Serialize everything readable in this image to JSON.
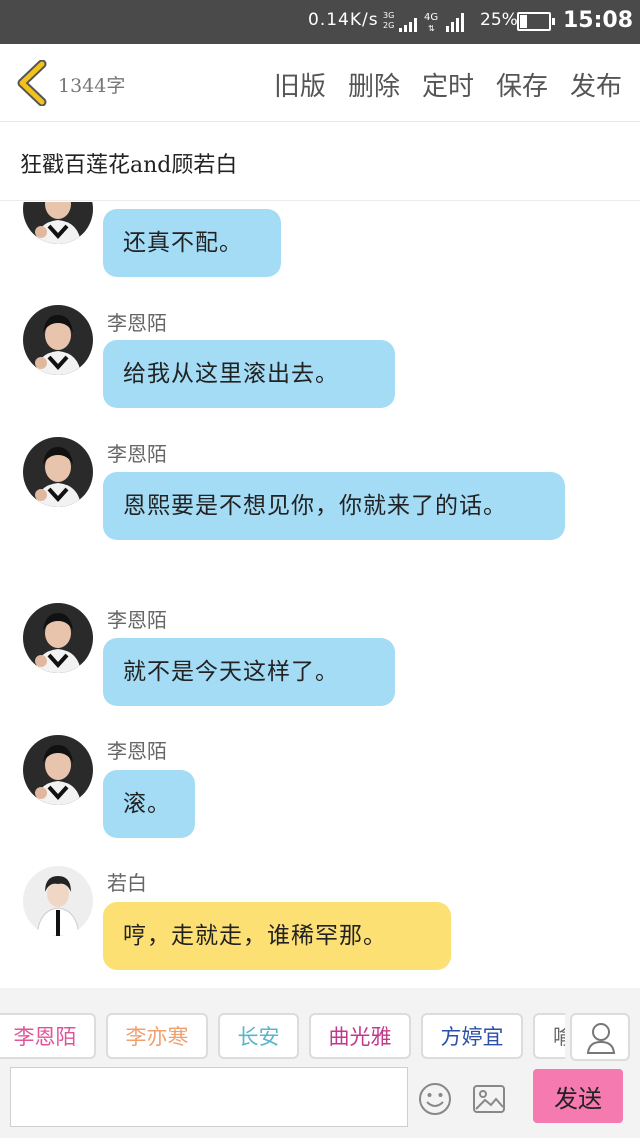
{
  "status_bar": {
    "net_speed": "0.14K/s",
    "sim1_label_top": "3G",
    "sim1_label_bottom": "2G",
    "sim2_label": "4G",
    "battery_percent": "25%",
    "battery_level": 0.25,
    "time": "15:08"
  },
  "header": {
    "word_count": "1344字",
    "actions": [
      "旧版",
      "删除",
      "定时",
      "保存",
      "发布"
    ]
  },
  "story_title": "狂戳百莲花and顾若白",
  "messages": [
    {
      "sender": "",
      "text": "还真不配。",
      "avatar": "female-avatar",
      "color": "blue"
    },
    {
      "sender": "李恩陌",
      "text": "给我从这里滚出去。",
      "avatar": "female-avatar",
      "color": "blue"
    },
    {
      "sender": "李恩陌",
      "text": "恩熙要是不想见你，你就来了的话。",
      "avatar": "female-avatar",
      "color": "blue"
    },
    {
      "sender": "李恩陌",
      "text": "就不是今天这样了。",
      "avatar": "female-avatar",
      "color": "blue"
    },
    {
      "sender": "李恩陌",
      "text": "滚。",
      "avatar": "female-avatar",
      "color": "blue"
    },
    {
      "sender": "若白",
      "text": "哼，走就走，谁稀罕那。",
      "avatar": "male-avatar",
      "color": "yellow"
    }
  ],
  "characters": [
    {
      "name": "李恩陌",
      "color": "#e0559a"
    },
    {
      "name": "李亦寒",
      "color": "#f0a070"
    },
    {
      "name": "长安",
      "color": "#5bb5c8"
    },
    {
      "name": "曲光雅",
      "color": "#c0398a"
    },
    {
      "name": "方婷宜",
      "color": "#2b4fa8"
    },
    {
      "name": "喻",
      "color": "#666666"
    }
  ],
  "input": {
    "placeholder": ""
  },
  "send_label": "发送",
  "colors": {
    "status_bar": "#4a4a4a",
    "blue_bubble": "#a4dcf6",
    "yellow_bubble": "#fde073",
    "send_button": "#f57ab0",
    "back_arrow": "#f4c21c"
  }
}
